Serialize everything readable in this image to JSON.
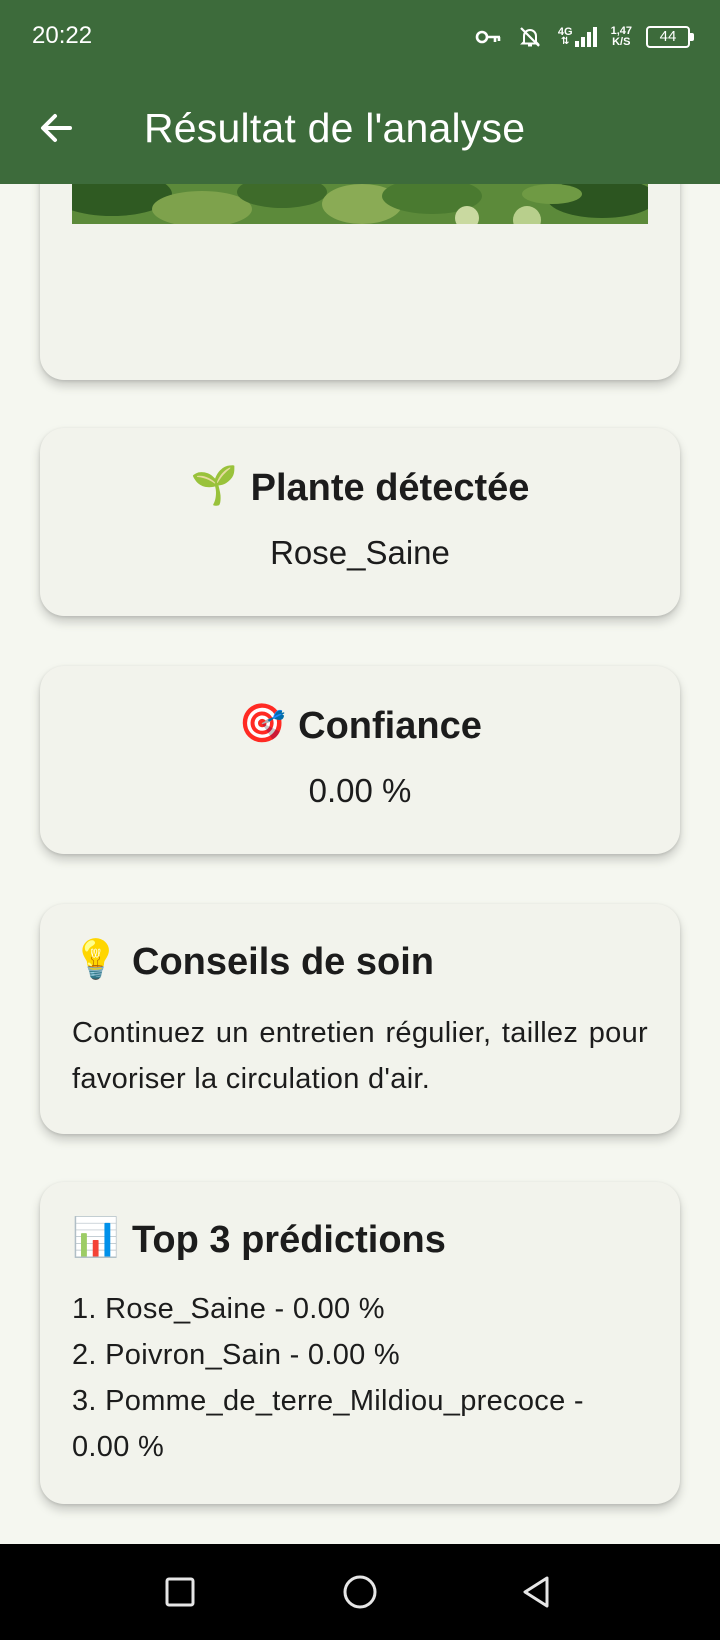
{
  "status_bar": {
    "time": "20:22",
    "network": "4G",
    "speed_value": "1,47",
    "speed_unit": "K/S",
    "battery": "44"
  },
  "toolbar": {
    "title": "Résultat de l'analyse",
    "back_icon": "arrow-left-icon"
  },
  "colors": {
    "app_bar": "#3d6b3b",
    "background": "#f5f7f0",
    "card": "#f2f3ec"
  },
  "cards": {
    "plant": {
      "emoji": "🌱",
      "title": "Plante détectée",
      "value": "Rose_Saine"
    },
    "confidence": {
      "emoji": "🎯",
      "title": "Confiance",
      "value": "0.00 %"
    },
    "tips": {
      "emoji": "💡",
      "title": "Conseils de soin",
      "text": "Continuez un entretien régulier, taillez pour favoriser la circulation d'air."
    },
    "top3": {
      "emoji": "📊",
      "title": "Top 3 prédictions",
      "items": [
        "1. Rose_Saine - 0.00 %",
        "2. Poivron_Sain - 0.00 %",
        "3. Pomme_de_terre_Mildiou_precoce - 0.00 %"
      ]
    }
  },
  "nav_bar": {
    "recents_icon": "square-icon",
    "home_icon": "circle-icon",
    "back_icon": "triangle-back-icon"
  }
}
